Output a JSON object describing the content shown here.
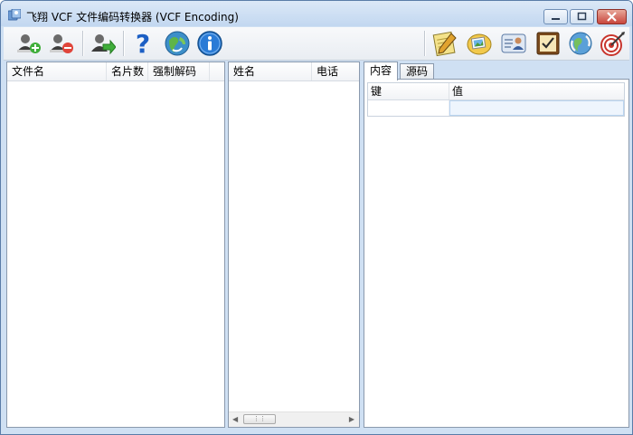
{
  "window": {
    "title": "飞翔 VCF 文件编码转换器 (VCF Encoding)"
  },
  "toolbar": {
    "buttons": [
      {
        "name": "add-contact",
        "icon": "person-add-icon"
      },
      {
        "name": "remove-contact",
        "icon": "person-remove-icon"
      },
      {
        "name": "export-contact",
        "icon": "person-export-icon"
      },
      {
        "name": "help",
        "icon": "question-icon"
      },
      {
        "name": "web",
        "icon": "globe-refresh-icon"
      },
      {
        "name": "about",
        "icon": "info-icon"
      }
    ],
    "right_buttons": [
      {
        "name": "notepad",
        "icon": "notepad-pencil-icon"
      },
      {
        "name": "photos",
        "icon": "photo-album-icon"
      },
      {
        "name": "contact-card",
        "icon": "contact-card-icon"
      },
      {
        "name": "checklist",
        "icon": "checklist-icon"
      },
      {
        "name": "sync",
        "icon": "globe-sync-icon"
      },
      {
        "name": "target",
        "icon": "dartboard-icon"
      }
    ]
  },
  "files_panel": {
    "columns": [
      "文件名",
      "名片数",
      "强制解码"
    ]
  },
  "contacts_panel": {
    "columns": [
      "姓名",
      "电话"
    ]
  },
  "detail_panel": {
    "tabs": [
      "内容",
      "源码"
    ],
    "active_tab": "内容",
    "columns": [
      "键",
      "值"
    ]
  },
  "colors": {
    "frame": "#cfe0f3",
    "close_button": "#c9463d",
    "help_icon": "#1c5fc4"
  }
}
